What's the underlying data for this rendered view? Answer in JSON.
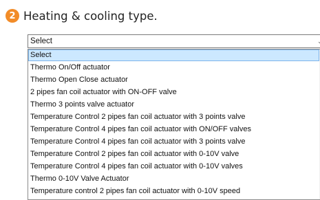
{
  "step": {
    "number": "2",
    "title": "Heating & cooling type."
  },
  "select": {
    "value": "Select",
    "arrow_icon": "chevron-down-icon"
  },
  "dropdown": {
    "selected_index": 0,
    "options": [
      "Select",
      "Thermo On/Off actuator",
      "Thermo Open Close actuator",
      "2 pipes fan coil actuator with ON-OFF valve",
      "Thermo 3 points valve actuator",
      "Temperature Control 2 pipes fan coil actuator with 3 points valve",
      "Temperature Control 4 pipes fan coil actuator with ON/OFF valves",
      "Temperature Control 4 pipes fan coil actuator with 3 points valve",
      "Temperature Control 2 pipes fan coil actuator with 0-10V valve",
      "Temperature Control 4 pipes fan coil actuator with 0-10V valves",
      "Thermo 0-10V Valve Actuator",
      "Temperature control 2 pipes fan coil actuator with 0-10V speed"
    ]
  },
  "colors": {
    "badge": "#f28c28",
    "highlight": "#cce8ff",
    "highlight_border": "#7eb4ea"
  }
}
